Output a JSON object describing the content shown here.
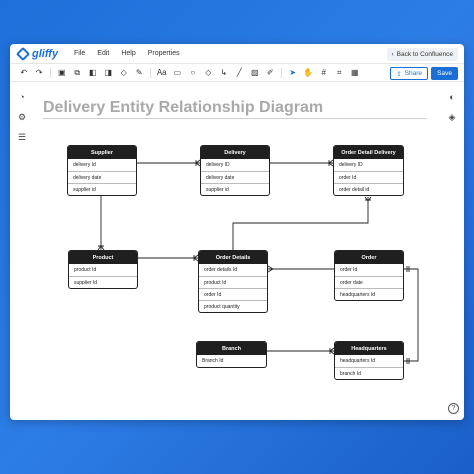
{
  "app": {
    "logo_text": "gliffy",
    "menu": [
      "File",
      "Edit",
      "Help",
      "Properties"
    ],
    "back_label": "Back to Confluence",
    "share_label": "Share",
    "save_label": "Save"
  },
  "toolbar": {
    "tools": [
      {
        "name": "undo-icon",
        "glyph": "↶"
      },
      {
        "name": "redo-icon",
        "glyph": "↷"
      },
      {
        "name": "group-icon",
        "glyph": "▣"
      },
      {
        "name": "ungroup-icon",
        "glyph": "⧉"
      },
      {
        "name": "bring-front-icon",
        "glyph": "◧"
      },
      {
        "name": "send-back-icon",
        "glyph": "◨"
      },
      {
        "name": "fill-icon",
        "glyph": "◇"
      },
      {
        "name": "line-color-icon",
        "glyph": "✎"
      },
      {
        "name": "text-icon",
        "glyph": "Aa"
      },
      {
        "name": "rectangle-icon",
        "glyph": "▭"
      },
      {
        "name": "ellipse-icon",
        "glyph": "○"
      },
      {
        "name": "diamond-icon",
        "glyph": "◇"
      },
      {
        "name": "connector-icon",
        "glyph": "↳"
      },
      {
        "name": "line-icon",
        "glyph": "╱"
      },
      {
        "name": "image-icon",
        "glyph": "▨"
      },
      {
        "name": "pen-icon",
        "glyph": "✐"
      },
      {
        "name": "pointer-icon",
        "glyph": "➤"
      },
      {
        "name": "hand-icon",
        "glyph": "✋"
      },
      {
        "name": "grid-icon",
        "glyph": "#"
      },
      {
        "name": "snap-grid-icon",
        "glyph": "⌗"
      },
      {
        "name": "table-icon",
        "glyph": "▦"
      }
    ],
    "active_tool": "pointer-icon"
  },
  "sidebar_left": [
    {
      "name": "shapes-icon",
      "glyph": "◔"
    },
    {
      "name": "hierarchy-icon",
      "glyph": "⚙"
    },
    {
      "name": "database-icon",
      "glyph": "☰"
    }
  ],
  "sidebar_right": [
    {
      "name": "palette-icon",
      "glyph": "◐"
    },
    {
      "name": "layers-icon",
      "glyph": "◈"
    }
  ],
  "help_glyph": "?",
  "diagram": {
    "title": "Delivery Entity Relationship Diagram",
    "entities": [
      {
        "id": "supplier",
        "name": "Supplier",
        "fields": [
          "delivery Id",
          "delivery date",
          "supplier id"
        ]
      },
      {
        "id": "delivery",
        "name": "Delivery",
        "fields": [
          "delivery ID",
          "delivery date",
          "supplier id"
        ]
      },
      {
        "id": "odd",
        "name": "Order Detail Delivery",
        "fields": [
          "delivery ID",
          "order Id",
          "order detail id"
        ]
      },
      {
        "id": "product",
        "name": "Product",
        "fields": [
          "product Id",
          "supplier Id"
        ]
      },
      {
        "id": "orderdetails",
        "name": "Order Details",
        "fields": [
          "order details Id",
          "product Id",
          "order Id",
          "product quantity"
        ]
      },
      {
        "id": "order",
        "name": "Order",
        "fields": [
          "order Id",
          "order date",
          "headquarters Id"
        ]
      },
      {
        "id": "branch",
        "name": "Branch",
        "fields": [
          "Branch Id"
        ]
      },
      {
        "id": "hq",
        "name": "Headquarters",
        "fields": [
          "headquarters Id",
          "branch Id"
        ]
      }
    ]
  }
}
